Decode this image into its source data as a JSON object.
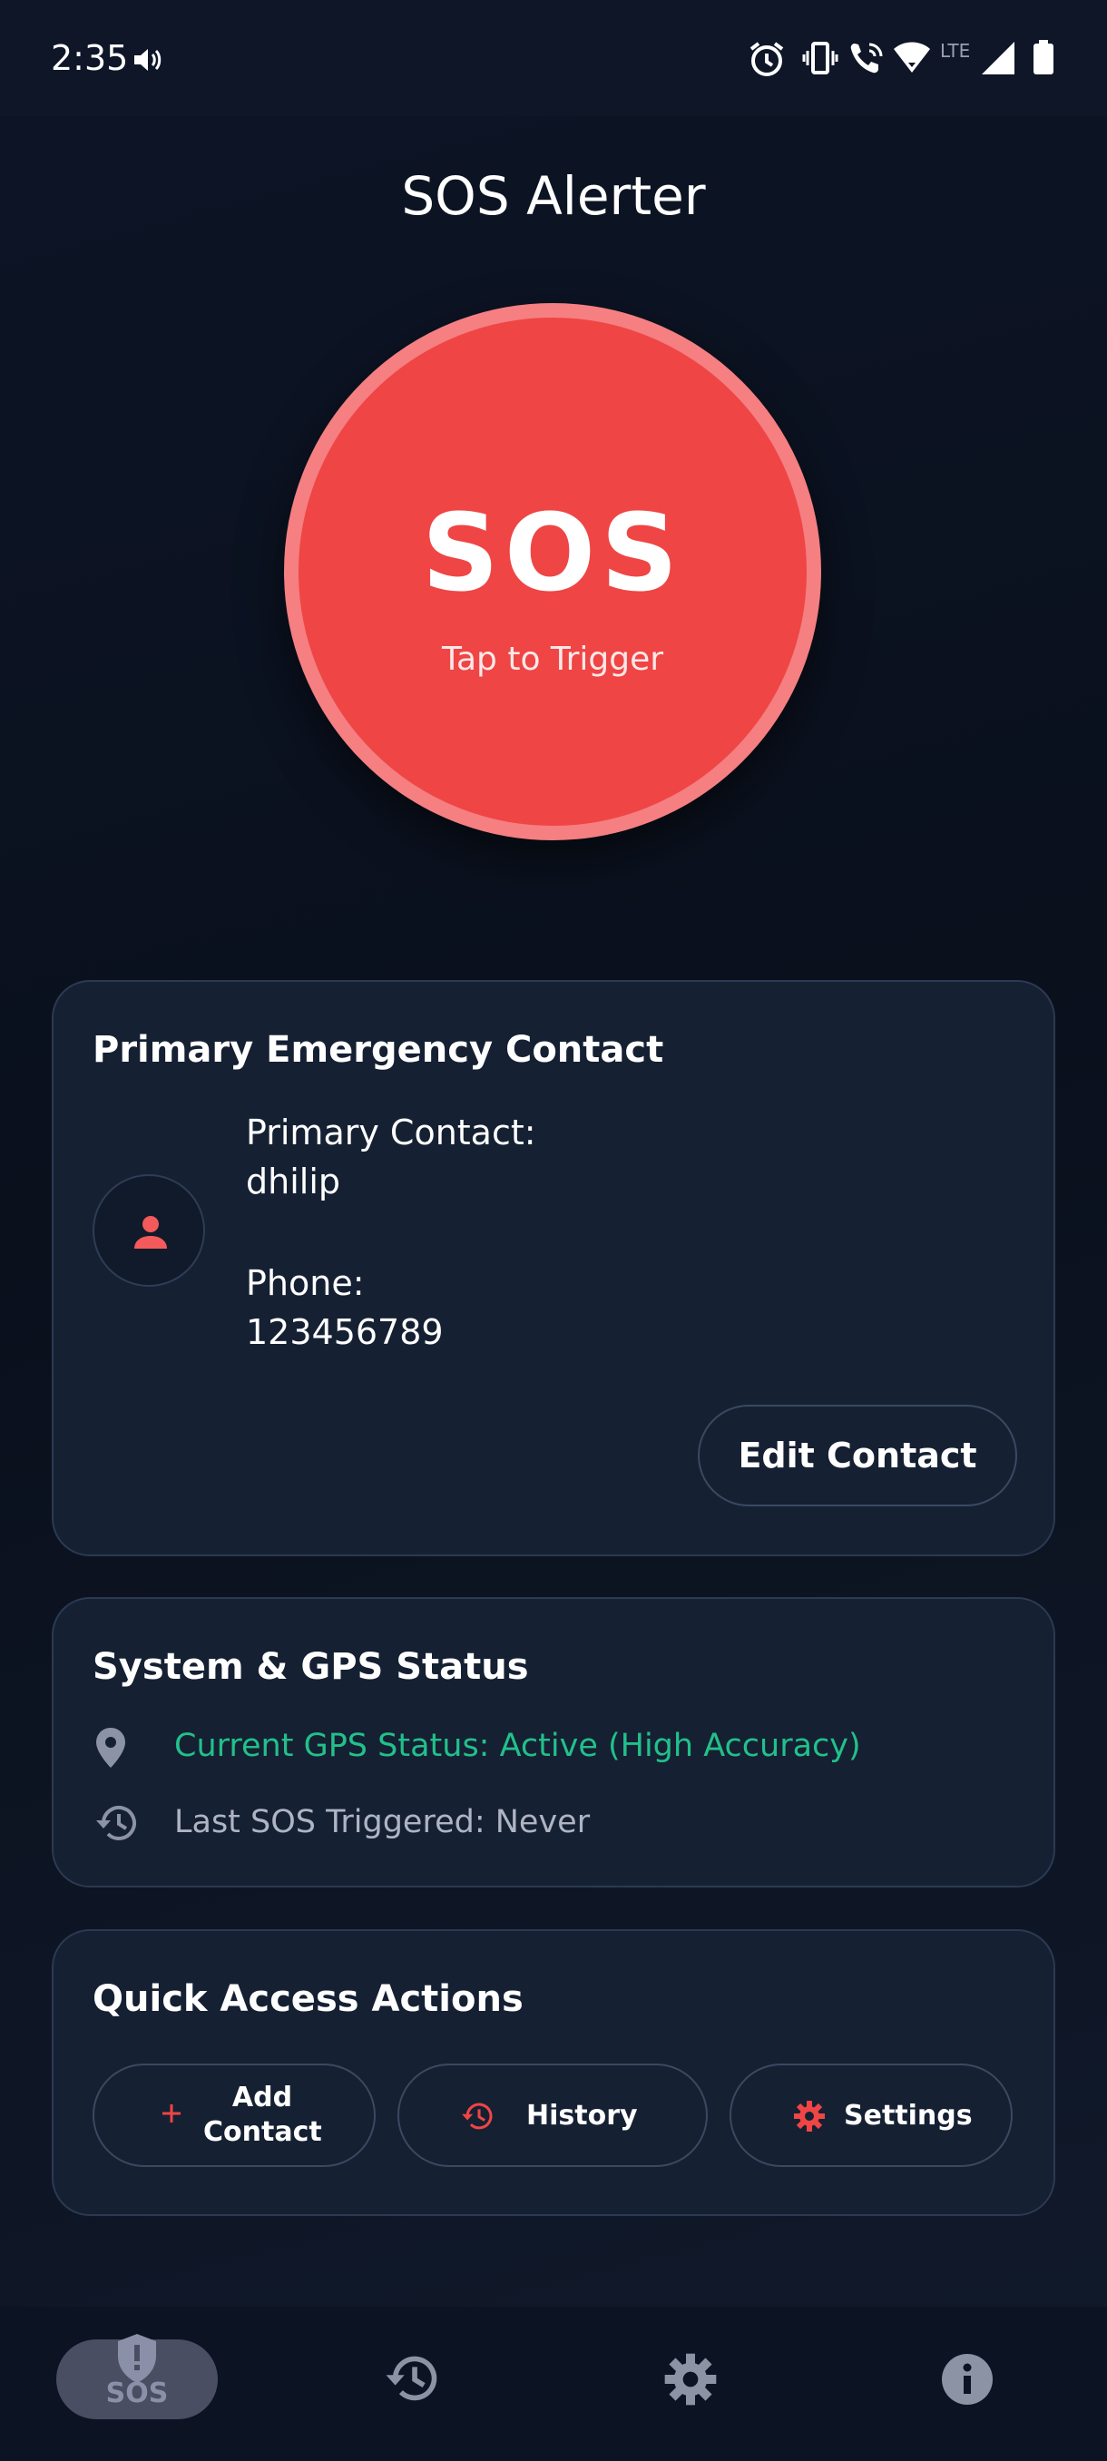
{
  "status_bar": {
    "time": "2:35",
    "icons": [
      "volume-icon",
      "alarm-icon",
      "vibrate-icon",
      "wifi-call-icon",
      "wifi-icon",
      "lte-icon",
      "signal-icon",
      "battery-icon"
    ],
    "network_label": "LTE"
  },
  "app": {
    "title": "SOS Alerter"
  },
  "sos_button": {
    "label": "SOS",
    "subtitle": "Tap to Trigger",
    "color": "#ef4545",
    "ring_color": "#f57f81"
  },
  "contact_card": {
    "title": "Primary Emergency Contact",
    "contact_label": "Primary Contact:",
    "contact_name": "dhilip",
    "phone_label": "Phone:",
    "phone_number": "123456789",
    "edit_label": "Edit Contact"
  },
  "status_card": {
    "title": "System & GPS Status",
    "gps_status": "Current GPS Status: Active (High Accuracy)",
    "gps_color": "#22c08a",
    "last_sos": "Last SOS Triggered: Never"
  },
  "quick_actions": {
    "title": "Quick Access Actions",
    "add_contact_line1": "Add",
    "add_contact_line2": "Contact",
    "history_label": "History",
    "settings_label": "Settings",
    "accent_color": "#ef4545"
  },
  "bottom_nav": {
    "sos_label": "SOS",
    "items": [
      "shield-alert-icon",
      "history-icon",
      "settings-icon",
      "info-icon"
    ]
  }
}
